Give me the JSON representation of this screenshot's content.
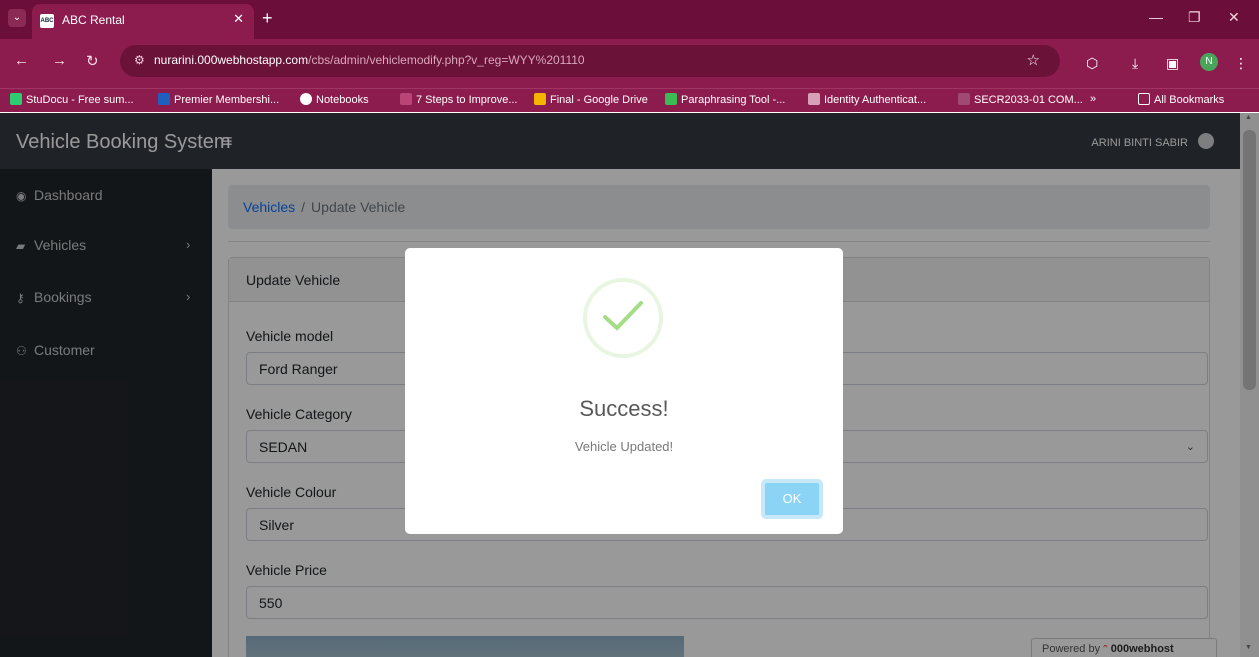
{
  "browser": {
    "tab_title": "ABC Rental",
    "tab_favicon_text": "ABC",
    "url_host": "nurarini.000webhostapp.com",
    "url_path": "/cbs/admin/vehiclemodify.php?v_reg=WYY%201110",
    "profile_initial": "N",
    "bookmarks": [
      "StuDocu - Free sum...",
      "Premier Membershi...",
      "Notebooks",
      "7 Steps to Improve...",
      "Final - Google Drive",
      "Paraphrasing Tool -...",
      "Identity Authenticat...",
      "SECR2033-01 COM...",
      "All Bookmarks"
    ],
    "more_bookmarks": "»"
  },
  "app": {
    "brand": "Vehicle Booking System",
    "user_name": "ARINI BINTI SABIR",
    "sidebar": {
      "items": [
        {
          "label": "Dashboard"
        },
        {
          "label": "Vehicles"
        },
        {
          "label": "Bookings"
        },
        {
          "label": "Customer"
        }
      ]
    },
    "breadcrumb": {
      "link": "Vehicles",
      "separator": "/",
      "current": "Update Vehicle"
    },
    "card_title": "Update Vehicle",
    "form": {
      "model_label": "Vehicle model",
      "model_value": "Ford Ranger",
      "category_label": "Vehicle Category",
      "category_value": "SEDAN",
      "colour_label": "Vehicle Colour",
      "colour_value": "Silver",
      "price_label": "Vehicle Price",
      "price_value": "550"
    },
    "powered_by": "Powered by",
    "powered_brand": "000webhost"
  },
  "modal": {
    "title": "Success!",
    "text": "Vehicle Updated!",
    "ok_label": "OK",
    "accent_color": "#a5dc86",
    "button_color": "#8cd4f5"
  }
}
